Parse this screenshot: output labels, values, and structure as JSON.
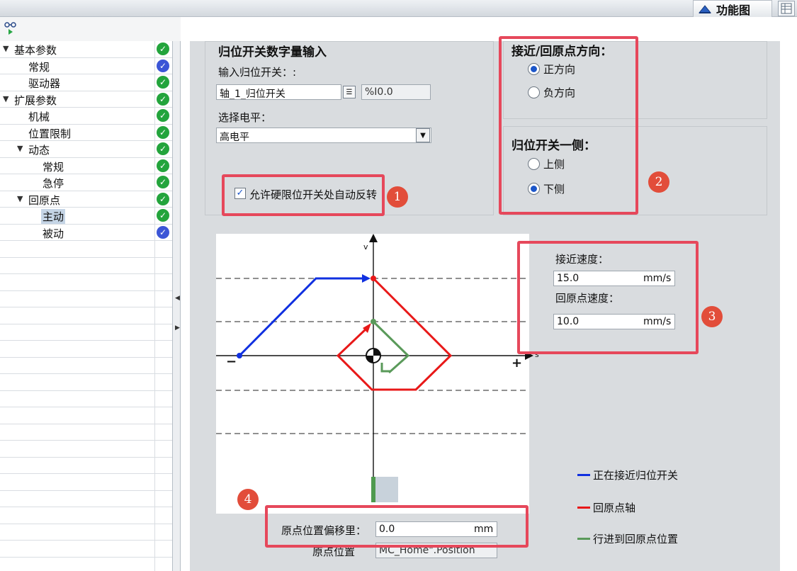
{
  "header": {
    "function_view_tab": "功能图"
  },
  "tree": {
    "items": [
      {
        "label": "基本参数",
        "status": "green"
      },
      {
        "label": "常规",
        "status": "blue"
      },
      {
        "label": "驱动器",
        "status": "green"
      },
      {
        "label": "扩展参数",
        "status": "green"
      },
      {
        "label": "机械",
        "status": "green"
      },
      {
        "label": "位置限制",
        "status": "green"
      },
      {
        "label": "动态",
        "status": "green"
      },
      {
        "label": "常规",
        "status": "green"
      },
      {
        "label": "急停",
        "status": "green"
      },
      {
        "label": "回原点",
        "status": "green"
      },
      {
        "label": "主动",
        "status": "green"
      },
      {
        "label": "被动",
        "status": "blue"
      }
    ]
  },
  "homing_switch": {
    "title": "归位开关数字量输入",
    "input_label": "输入归位开关：:",
    "input_value": "轴_1_归位开关",
    "address": "%I0.0",
    "level_label": "选择电平：",
    "level_value": "高电平",
    "auto_reverse_label": "允许硬限位开关处自动反转",
    "auto_reverse_checked": true
  },
  "direction": {
    "title": "接近/回原点方向：",
    "options": [
      "正方向",
      "负方向"
    ],
    "selected": "正方向"
  },
  "switch_side": {
    "title": "归位开关一侧：",
    "options": [
      "上侧",
      "下侧"
    ],
    "selected": "下侧"
  },
  "speeds": {
    "approach_label": "接近速度：",
    "approach_value": "15.0",
    "homing_label": "回原点速度：",
    "homing_value": "10.0",
    "unit": "mm/s"
  },
  "diagram": {
    "v_axis_label": "v",
    "s_axis_label": "s",
    "minus": "−",
    "plus": "+",
    "colors": {
      "approach": "#1030e0",
      "homing": "#e81818",
      "travel": "#5a9a5a"
    }
  },
  "legend": [
    {
      "label": "正在接近归位开关",
      "color": "#1030e0"
    },
    {
      "label": "回原点轴",
      "color": "#e81818"
    },
    {
      "label": "行进到回原点位置",
      "color": "#5a9a5a"
    }
  ],
  "offset": {
    "label": "原点位置偏移里：",
    "value": "0.0",
    "unit": "mm",
    "position_label": "原点位置",
    "position_value": "MC_Home\".Position"
  },
  "badges": [
    "1",
    "2",
    "3",
    "4"
  ]
}
